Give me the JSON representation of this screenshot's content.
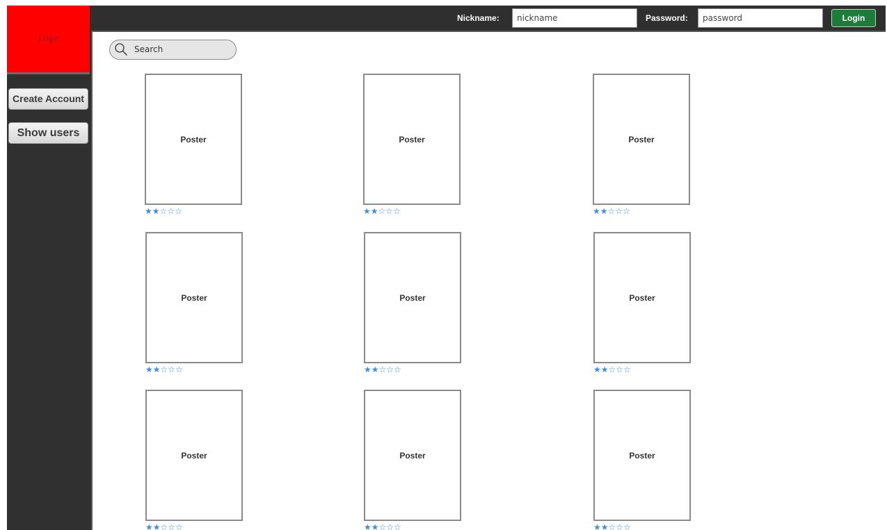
{
  "sidebar": {
    "logo": "Logo",
    "items": [
      {
        "label": "Create Account"
      },
      {
        "label": "Show users"
      }
    ]
  },
  "header": {
    "nickname_label": "Nickname:",
    "nickname_value": "nickname",
    "password_label": "Password:",
    "password_value": "password",
    "login_label": "Login"
  },
  "search": {
    "placeholder": "Search",
    "icon": "search-icon"
  },
  "posters": [
    {
      "label": "Poster",
      "rating": 2,
      "max_rating": 5
    },
    {
      "label": "Poster",
      "rating": 2,
      "max_rating": 5
    },
    {
      "label": "Poster",
      "rating": 2,
      "max_rating": 5
    },
    {
      "label": "Poster",
      "rating": 2,
      "max_rating": 5
    },
    {
      "label": "Poster",
      "rating": 2,
      "max_rating": 5
    },
    {
      "label": "Poster",
      "rating": 2,
      "max_rating": 5
    },
    {
      "label": "Poster",
      "rating": 2,
      "max_rating": 5
    },
    {
      "label": "Poster",
      "rating": 2,
      "max_rating": 5
    },
    {
      "label": "Poster",
      "rating": 2,
      "max_rating": 5
    }
  ],
  "colors": {
    "logo_bg": "#ff0000",
    "sidebar_bg": "#303030",
    "header_bg": "#2f2f2f",
    "login_button": "#1d7c3a",
    "star": "#3c8fdb"
  }
}
